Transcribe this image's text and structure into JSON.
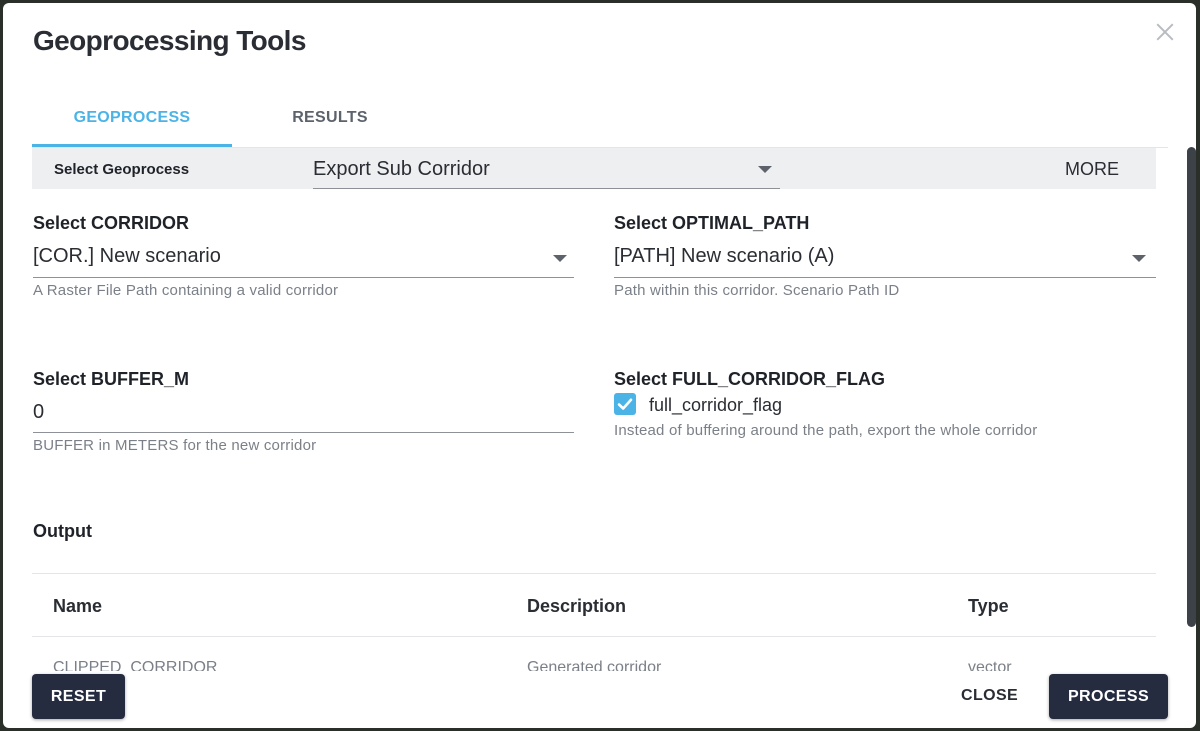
{
  "dialog": {
    "title": "Geoprocessing Tools",
    "close_icon": "close-icon"
  },
  "tabs": [
    {
      "label": "GEOPROCESS",
      "active": true
    },
    {
      "label": "RESULTS",
      "active": false
    }
  ],
  "geoprocess": {
    "label": "Select Geoprocess",
    "value": "Export Sub Corridor",
    "more_label": "MORE"
  },
  "fields": {
    "corridor": {
      "label": "Select CORRIDOR",
      "value": "[COR.] New scenario",
      "helper": "A Raster File Path containing a valid corridor"
    },
    "optimal_path": {
      "label": "Select OPTIMAL_PATH",
      "value": "[PATH] New scenario (A)",
      "helper": "Path within this corridor. Scenario Path ID"
    },
    "buffer": {
      "label": "Select BUFFER_M",
      "value": "0",
      "helper": "BUFFER in METERS for the new corridor"
    },
    "full_corridor_flag": {
      "label": "Select FULL_CORRIDOR_FLAG",
      "checkbox_label": "full_corridor_flag",
      "checked": true,
      "helper": "Instead of buffering around the path, export the whole corridor"
    }
  },
  "output": {
    "heading": "Output",
    "columns": [
      "Name",
      "Description",
      "Type"
    ],
    "rows": [
      [
        "CLIPPED_CORRIDOR",
        "Generated corridor",
        "vector"
      ]
    ]
  },
  "footer": {
    "reset_label": "RESET",
    "close_label": "CLOSE",
    "process_label": "PROCESS"
  },
  "colors": {
    "accent": "#4cb3e6",
    "button_bg": "#262c40"
  }
}
